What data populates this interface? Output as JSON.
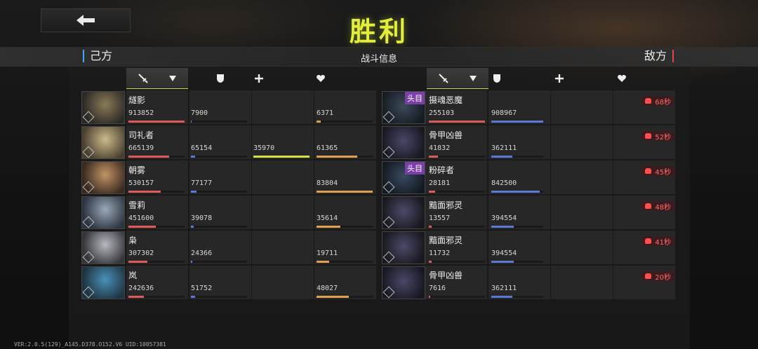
{
  "title": "胜利",
  "header": {
    "left_label": "己方",
    "center_label": "战斗信息",
    "right_label": "敌方"
  },
  "icons": {
    "back": "back-arrow-icon",
    "damage": "sword-icon",
    "defense": "shield-icon",
    "heal": "plus-icon",
    "hp": "heart-icon",
    "sort": "caret-down-icon"
  },
  "colors": {
    "title": "#e2ee3a",
    "damage": "#e05a5a",
    "defense": "#5a7ad8",
    "heal": "#d8e040",
    "hp": "#e0a050",
    "timer": "#ff6a6a",
    "boss_tag": "#7b3fa8"
  },
  "allies": [
    {
      "name": "燧影",
      "damage": "913852",
      "defense": "7900",
      "heal": "",
      "hp": "6371",
      "damage_frac": 1.0,
      "defense_frac": 0.01,
      "heal_frac": 0,
      "hp_frac": 0.08
    },
    {
      "name": "司礼者",
      "damage": "665139",
      "defense": "65154",
      "heal": "35970",
      "hp": "61365",
      "damage_frac": 0.72,
      "defense_frac": 0.08,
      "heal_frac": 1.0,
      "hp_frac": 0.73
    },
    {
      "name": "朝雾",
      "damage": "530157",
      "defense": "77177",
      "heal": "",
      "hp": "83804",
      "damage_frac": 0.58,
      "defense_frac": 0.1,
      "heal_frac": 0,
      "hp_frac": 1.0
    },
    {
      "name": "雪莉",
      "damage": "451600",
      "defense": "39078",
      "heal": "",
      "hp": "35614",
      "damage_frac": 0.49,
      "defense_frac": 0.05,
      "heal_frac": 0,
      "hp_frac": 0.42
    },
    {
      "name": "枭",
      "damage": "307302",
      "defense": "24366",
      "heal": "",
      "hp": "19711",
      "damage_frac": 0.34,
      "defense_frac": 0.03,
      "heal_frac": 0,
      "hp_frac": 0.23
    },
    {
      "name": "岚",
      "damage": "242636",
      "defense": "51752",
      "heal": "",
      "hp": "48027",
      "damage_frac": 0.27,
      "defense_frac": 0.07,
      "heal_frac": 0,
      "hp_frac": 0.57
    }
  ],
  "enemies": [
    {
      "name": "摄魂恶魔",
      "tag": "头目",
      "damage": "255103",
      "defense": "908967",
      "timer": "68秒",
      "damage_frac": 1.0,
      "defense_frac": 1.0
    },
    {
      "name": "骨甲凶兽",
      "tag": "",
      "damage": "41832",
      "defense": "362111",
      "timer": "52秒",
      "damage_frac": 0.16,
      "defense_frac": 0.4
    },
    {
      "name": "粉碎者",
      "tag": "头目",
      "damage": "28181",
      "defense": "842500",
      "timer": "45秒",
      "damage_frac": 0.11,
      "defense_frac": 0.93
    },
    {
      "name": "黯面邪灵",
      "tag": "",
      "damage": "13557",
      "defense": "394554",
      "timer": "48秒",
      "damage_frac": 0.05,
      "defense_frac": 0.43
    },
    {
      "name": "黯面邪灵",
      "tag": "",
      "damage": "11732",
      "defense": "394554",
      "timer": "41秒",
      "damage_frac": 0.05,
      "defense_frac": 0.43
    },
    {
      "name": "骨甲凶兽",
      "tag": "",
      "damage": "7616",
      "defense": "362111",
      "timer": "20秒",
      "damage_frac": 0.03,
      "defense_frac": 0.4
    }
  ],
  "footer": "VER:2.0.5(129)_A145.D378.O152.V6  UID:10057381"
}
